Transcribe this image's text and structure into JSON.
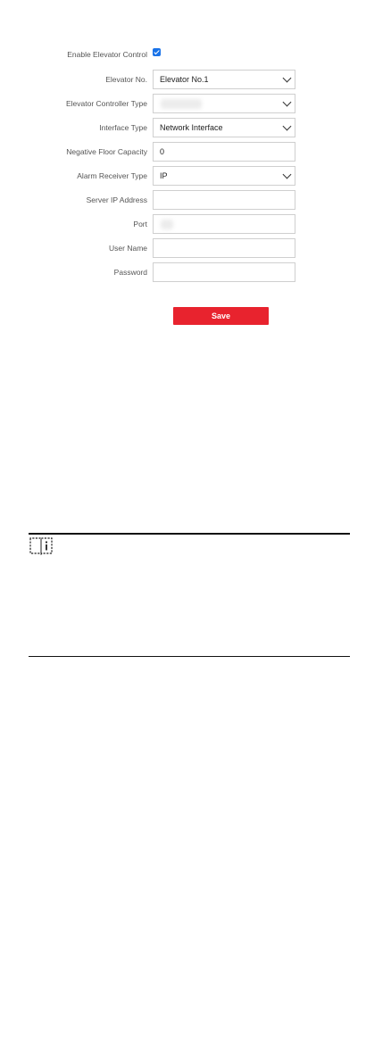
{
  "form": {
    "enable_elevator_control": {
      "label": "Enable Elevator Control",
      "checked": true
    },
    "elevator_no": {
      "label": "Elevator No.",
      "value": "Elevator No.1"
    },
    "elevator_controller_type": {
      "label": "Elevator Controller Type",
      "value": ""
    },
    "interface_type": {
      "label": "Interface Type",
      "value": "Network Interface"
    },
    "negative_floor_capacity": {
      "label": "Negative Floor Capacity",
      "value": "0"
    },
    "alarm_receiver_type": {
      "label": "Alarm Receiver Type",
      "value": "IP"
    },
    "server_ip_address": {
      "label": "Server IP Address",
      "value": ""
    },
    "port": {
      "label": "Port",
      "value": ""
    },
    "user_name": {
      "label": "User Name",
      "value": ""
    },
    "password": {
      "label": "Password",
      "value": ""
    }
  },
  "actions": {
    "save_label": "Save"
  },
  "colors": {
    "accent": "#e8232e",
    "checkbox": "#1a73e8",
    "border": "#cfcfcf"
  },
  "note": {
    "icon": "book-info-icon"
  }
}
